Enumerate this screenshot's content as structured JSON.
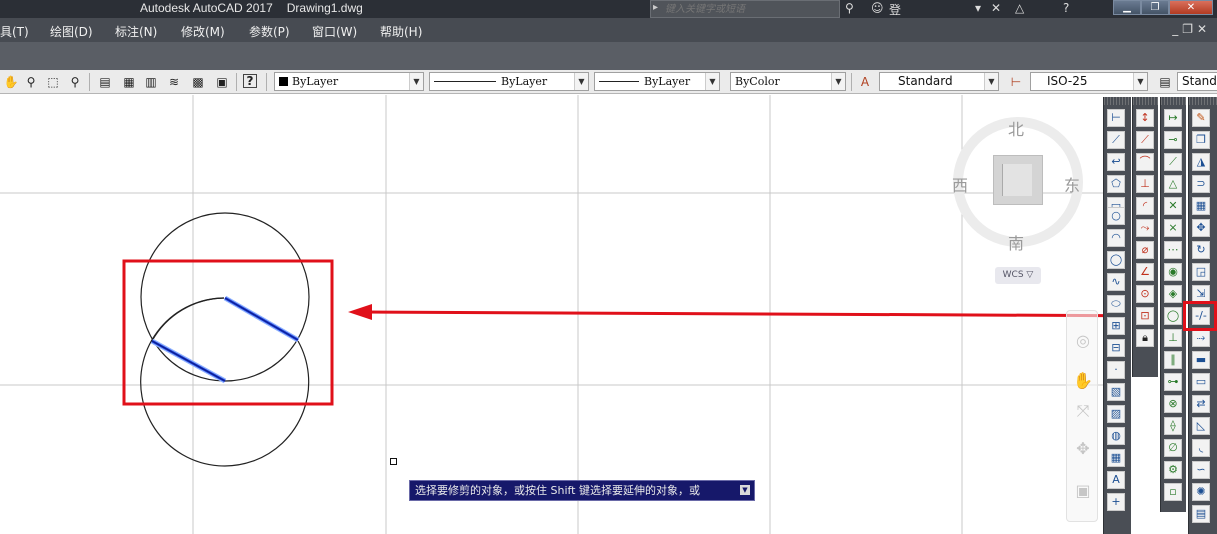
{
  "titlebar": {
    "menu_fragment": "具",
    "app_title": "Autodesk AutoCAD 2017",
    "file_name": "Drawing1.dwg",
    "search_placeholder": "键入关键字或短语",
    "login_label": "登录"
  },
  "menubar": {
    "items": [
      "具(T)",
      "绘图(D)",
      "标注(N)",
      "修改(M)",
      "参数(P)",
      "窗口(W)",
      "帮助(H)"
    ]
  },
  "toolbar": {
    "layer_combo": "ByLayer",
    "linetype_combo": "ByLayer",
    "lineweight_combo": "ByLayer",
    "plotstyle_combo": "ByColor",
    "text_style_combo": "Standard",
    "dim_style_combo": "ISO-25",
    "table_style_combo": "Standa"
  },
  "viewcube": {
    "north": "北",
    "south": "南",
    "east": "东",
    "west": "西",
    "wcs_label": "WCS"
  },
  "command_tooltip": {
    "text": "选择要修剪的对象，或按住 Shift 键选择要延伸的对象，或"
  },
  "colors": {
    "highlight_red": "#e0101a",
    "selection_blue": "#1c3ad6",
    "tooltip_bg": "#16186a"
  },
  "icons": [
    "pan-icon",
    "zoom-realtime-icon",
    "zoom-window-icon",
    "zoom-previous-icon",
    "properties-icon",
    "design-center-icon",
    "tool-palettes-icon",
    "sheet-set-icon",
    "markup-icon",
    "calculator-icon",
    "help-icon",
    "trim-icon"
  ]
}
